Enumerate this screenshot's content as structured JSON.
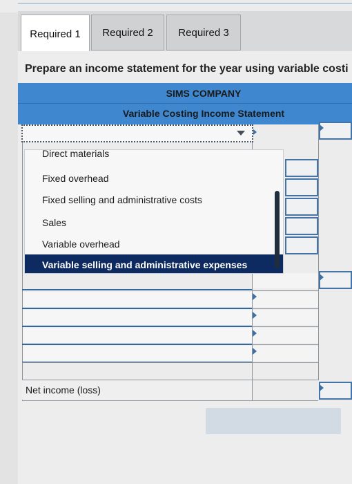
{
  "tabs": [
    {
      "label": "Required 1",
      "active": true
    },
    {
      "label": "Required 2",
      "active": false
    },
    {
      "label": "Required 3",
      "active": false
    }
  ],
  "prompt": "Prepare an income statement for the year using variable costi",
  "statement": {
    "company": "SIMS COMPANY",
    "title": "Variable Costing Income Statement"
  },
  "dropdown": {
    "selected_value": "",
    "options": [
      {
        "label": "Direct materials",
        "selected": false
      },
      {
        "label": "Fixed overhead",
        "selected": false
      },
      {
        "label": "Fixed selling and administrative costs",
        "selected": false
      },
      {
        "label": "Sales",
        "selected": false
      },
      {
        "label": "Variable overhead",
        "selected": false
      },
      {
        "label": "Variable selling and administrative expenses",
        "selected": true
      }
    ]
  },
  "net_income_label": "Net income (loss)",
  "colors": {
    "header_blue": "#3f88cf",
    "selected_item": "#0d2b61",
    "grid_line": "#33689d"
  }
}
